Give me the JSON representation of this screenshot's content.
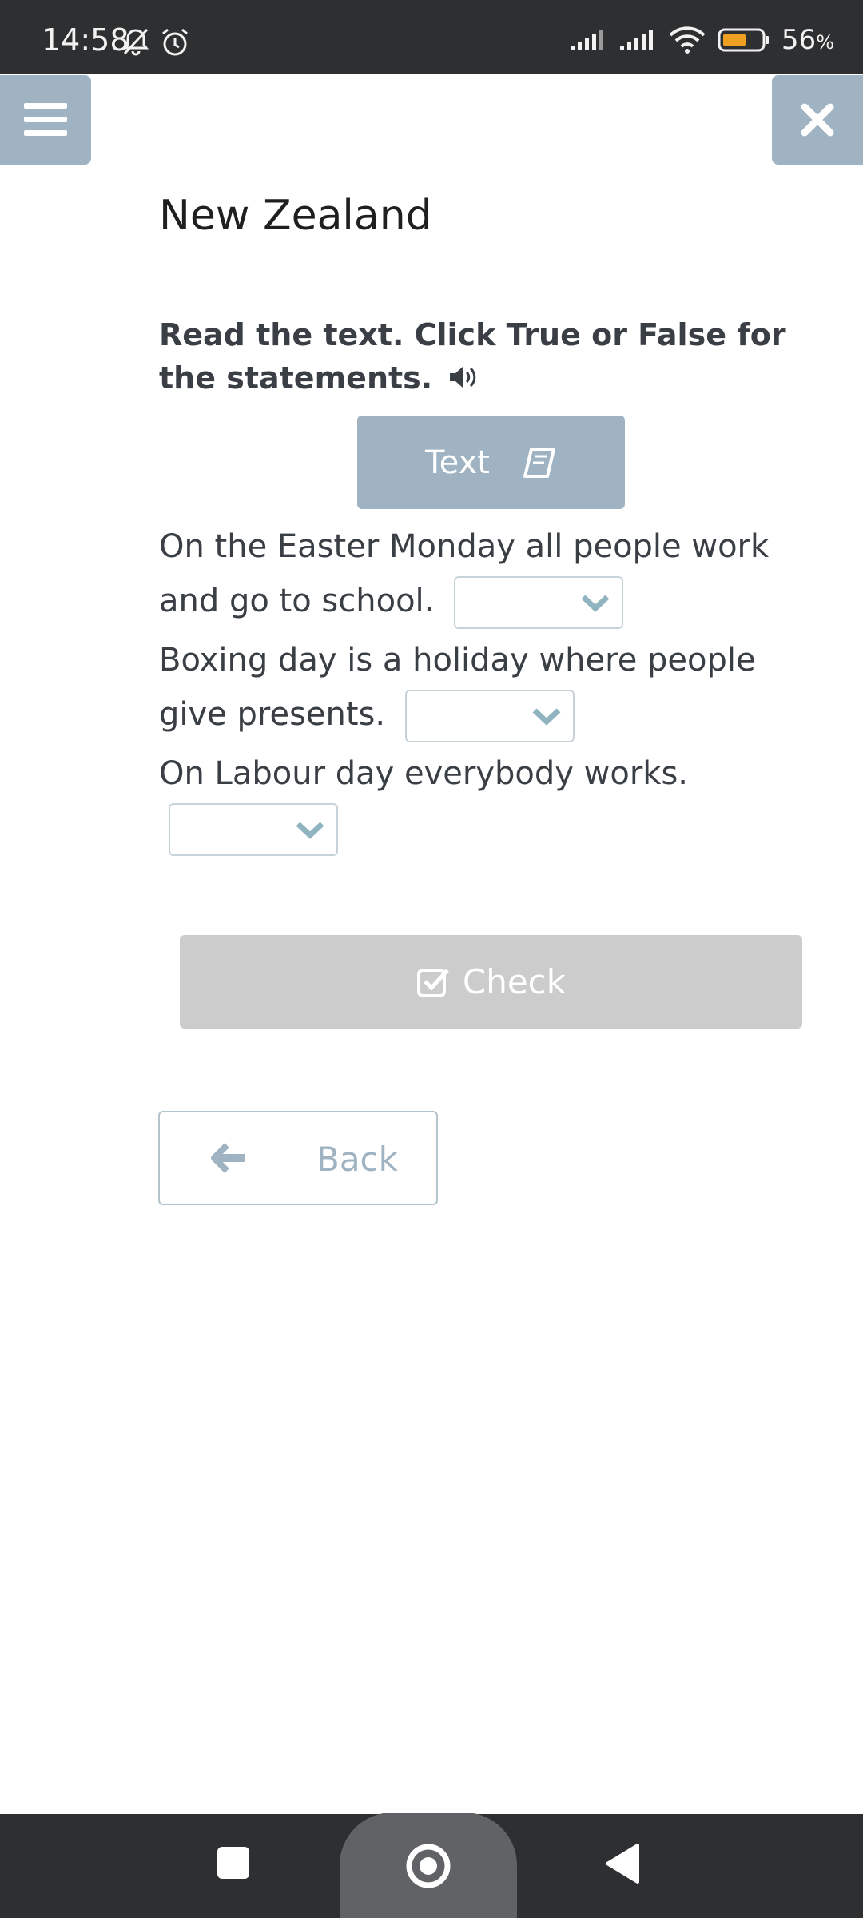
{
  "status_bar": {
    "time": "14:58",
    "battery_percent": "56",
    "battery_unit": "%"
  },
  "header": {
    "menu_icon": "hamburger-icon",
    "close_icon": "close-icon"
  },
  "page": {
    "title": "New Zealand",
    "instruction": "Read the text. Click True or False for the statements.",
    "text_button_label": "Text"
  },
  "statements": [
    {
      "text": "On the Easter Monday all people work and go to school.",
      "answer": ""
    },
    {
      "text": "Boxing day is a holiday where people give presents.",
      "answer": ""
    },
    {
      "text": "On Labour day everybody works.",
      "answer": ""
    }
  ],
  "actions": {
    "check_label": "Check",
    "back_label": "Back"
  },
  "colors": {
    "accent": "#9fb3c2",
    "disabled": "#cccccc",
    "status_bar": "#2e2f31",
    "battery": "#f0a020",
    "chevron": "#8fb4bf"
  }
}
